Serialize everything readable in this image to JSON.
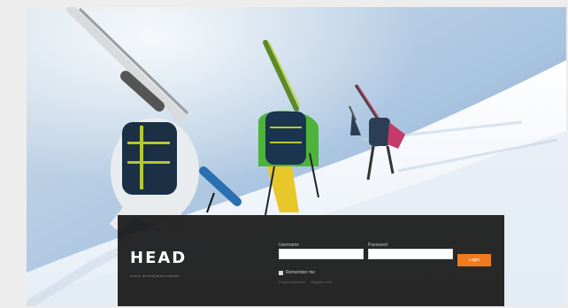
{
  "brand": {
    "logo": "HEAD",
    "tagline": "online development system"
  },
  "login": {
    "username_label": "Username",
    "password_label": "Password",
    "username_value": "",
    "password_value": "",
    "login_button": "Login",
    "remember_label": "Remember me",
    "links": [
      "Forgot password",
      "Register now"
    ]
  },
  "colors": {
    "accent": "#f07a1e",
    "panel": "#121212"
  }
}
